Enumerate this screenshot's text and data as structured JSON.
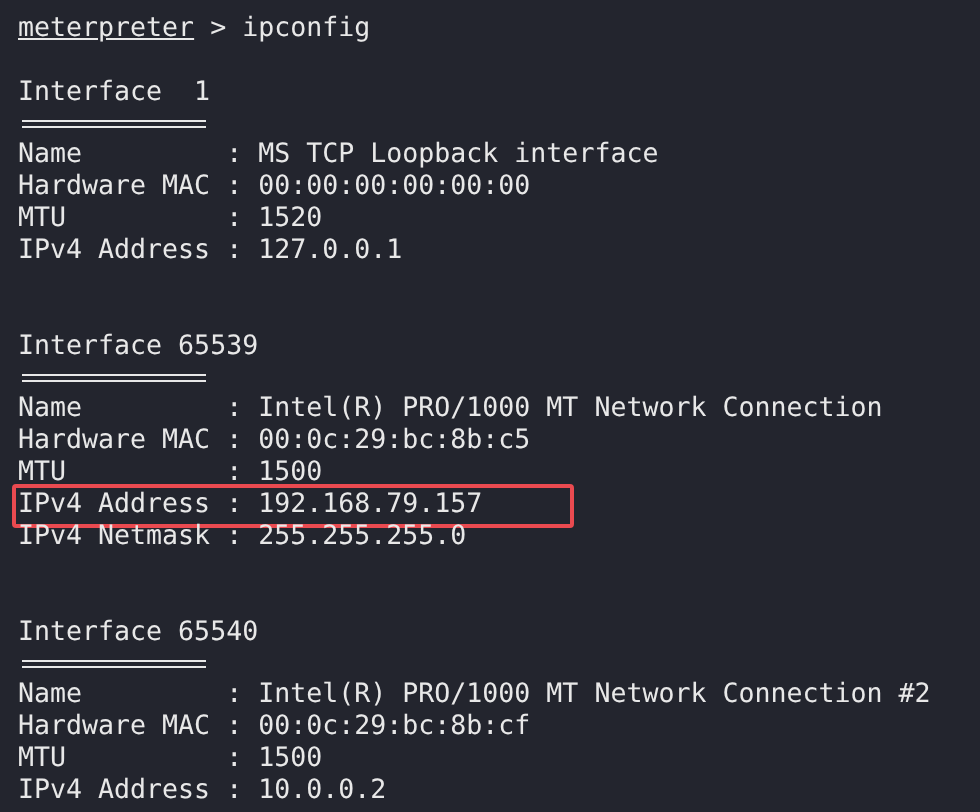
{
  "prompt": {
    "context": "meterpreter",
    "symbol": ">",
    "command": "ipconfig"
  },
  "interfaces": [
    {
      "title": "Interface  1",
      "lines": [
        {
          "text": "Name         : MS TCP Loopback interface",
          "highlighted": false
        },
        {
          "text": "Hardware MAC : 00:00:00:00:00:00",
          "highlighted": false
        },
        {
          "text": "MTU          : 1520",
          "highlighted": false
        },
        {
          "text": "IPv4 Address : 127.0.0.1",
          "highlighted": false
        }
      ]
    },
    {
      "title": "Interface 65539",
      "lines": [
        {
          "text": "Name         : Intel(R) PRO/1000 MT Network Connection",
          "highlighted": false
        },
        {
          "text": "Hardware MAC : 00:0c:29:bc:8b:c5",
          "highlighted": false
        },
        {
          "text": "MTU          : 1500",
          "highlighted": false
        },
        {
          "text": "IPv4 Address : 192.168.79.157",
          "highlighted": true
        },
        {
          "text": "IPv4 Netmask : 255.255.255.0",
          "highlighted": false
        }
      ]
    },
    {
      "title": "Interface 65540",
      "lines": [
        {
          "text": "Name         : Intel(R) PRO/1000 MT Network Connection #2",
          "highlighted": false
        },
        {
          "text": "Hardware MAC : 00:0c:29:bc:8b:cf",
          "highlighted": false
        },
        {
          "text": "MTU          : 1500",
          "highlighted": false
        },
        {
          "text": "IPv4 Address : 10.0.0.2",
          "highlighted": false
        }
      ]
    }
  ]
}
